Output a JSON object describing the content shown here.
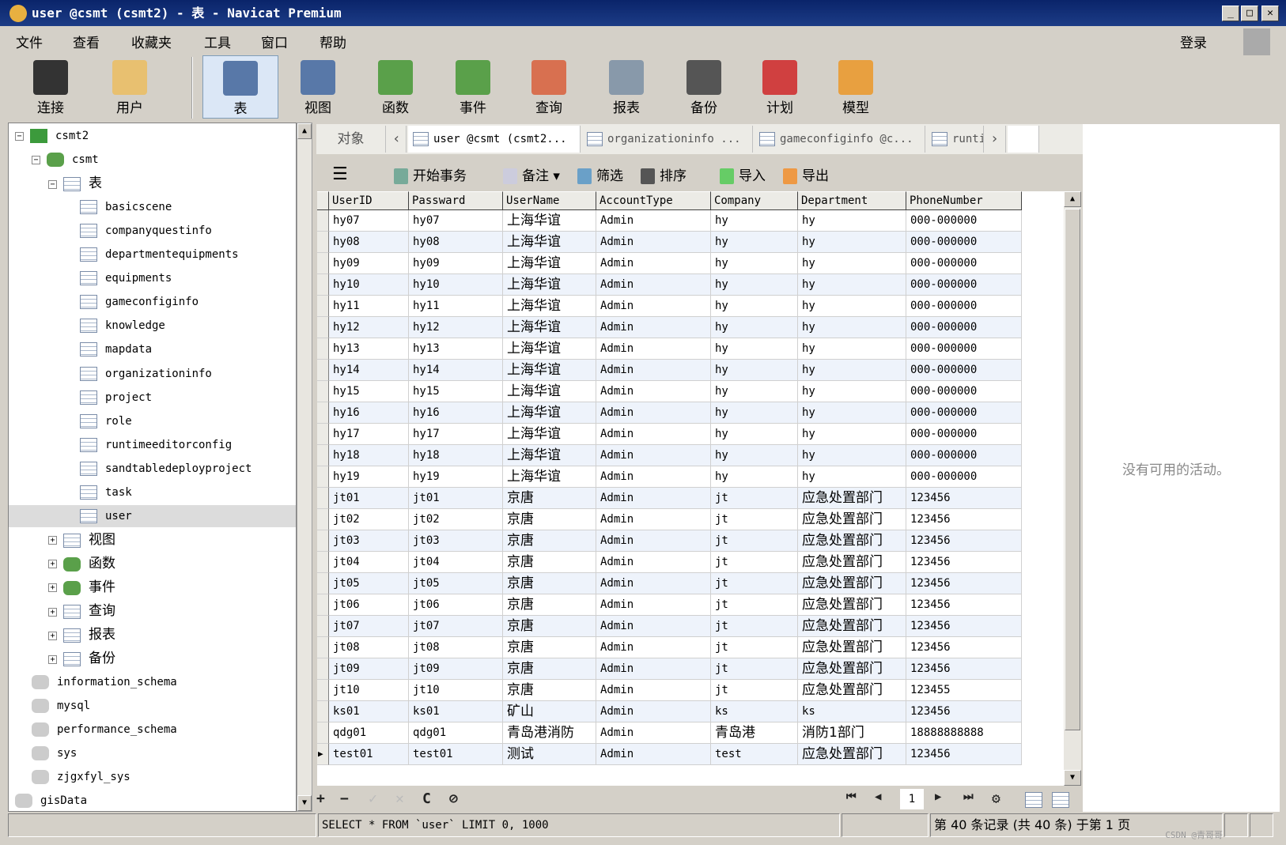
{
  "window": {
    "title": "user @csmt (csmt2) - 表 - Navicat Premium",
    "min": "_",
    "max": "□",
    "close": "✕"
  },
  "menu": [
    "文件",
    "查看",
    "收藏夹",
    "工具",
    "窗口",
    "帮助"
  ],
  "account": {
    "login": "登录"
  },
  "toolbar": [
    {
      "label": "连接",
      "icon": "connection-icon",
      "color": "#333"
    },
    {
      "label": "用户",
      "icon": "user-icon",
      "color": "#e8c070"
    },
    {
      "label": "表",
      "icon": "table-icon",
      "color": "#5878a8"
    },
    {
      "label": "视图",
      "icon": "view-icon",
      "color": "#5878a8"
    },
    {
      "label": "函数",
      "icon": "function-icon",
      "color": "#5aa04a"
    },
    {
      "label": "事件",
      "icon": "event-icon",
      "color": "#5aa04a"
    },
    {
      "label": "查询",
      "icon": "query-icon",
      "color": "#d87050"
    },
    {
      "label": "报表",
      "icon": "report-icon",
      "color": "#8899aa"
    },
    {
      "label": "备份",
      "icon": "backup-icon",
      "color": "#555"
    },
    {
      "label": "计划",
      "icon": "schedule-icon",
      "color": "#d04040"
    },
    {
      "label": "模型",
      "icon": "model-icon",
      "color": "#e8a040"
    }
  ],
  "tree": [
    {
      "label": "csmt2",
      "level": 0,
      "exp": "−",
      "icon": "conn"
    },
    {
      "label": "csmt",
      "level": 1,
      "exp": "−",
      "icon": "db"
    },
    {
      "label": "表",
      "level": 2,
      "exp": "−",
      "icon": "table"
    },
    {
      "label": "basicscene",
      "level": 3,
      "icon": "table"
    },
    {
      "label": "companyquestinfo",
      "level": 3,
      "icon": "table"
    },
    {
      "label": "departmentequipments",
      "level": 3,
      "icon": "table"
    },
    {
      "label": "equipments",
      "level": 3,
      "icon": "table"
    },
    {
      "label": "gameconfiginfo",
      "level": 3,
      "icon": "table"
    },
    {
      "label": "knowledge",
      "level": 3,
      "icon": "table"
    },
    {
      "label": "mapdata",
      "level": 3,
      "icon": "table"
    },
    {
      "label": "organizationinfo",
      "level": 3,
      "icon": "table"
    },
    {
      "label": "project",
      "level": 3,
      "icon": "table"
    },
    {
      "label": "role",
      "level": 3,
      "icon": "table"
    },
    {
      "label": "runtimeeditorconfig",
      "level": 3,
      "icon": "table"
    },
    {
      "label": "sandtabledeployproject",
      "level": 3,
      "icon": "table"
    },
    {
      "label": "task",
      "level": 3,
      "icon": "table"
    },
    {
      "label": "user",
      "level": 3,
      "icon": "table",
      "selected": true
    },
    {
      "label": "视图",
      "level": 2,
      "exp": "+",
      "icon": "table"
    },
    {
      "label": "函数",
      "level": 2,
      "exp": "+",
      "icon": "db"
    },
    {
      "label": "事件",
      "level": 2,
      "exp": "+",
      "icon": "db"
    },
    {
      "label": "查询",
      "level": 2,
      "exp": "+",
      "icon": "table"
    },
    {
      "label": "报表",
      "level": 2,
      "exp": "+",
      "icon": "table"
    },
    {
      "label": "备份",
      "level": 2,
      "exp": "+",
      "icon": "table"
    },
    {
      "label": "information_schema",
      "level": 1,
      "icon": "gray"
    },
    {
      "label": "mysql",
      "level": 1,
      "icon": "gray"
    },
    {
      "label": "performance_schema",
      "level": 1,
      "icon": "gray"
    },
    {
      "label": "sys",
      "level": 1,
      "icon": "gray"
    },
    {
      "label": "zjgxfyl_sys",
      "level": 1,
      "icon": "gray"
    },
    {
      "label": "gisData",
      "level": 0,
      "icon": "gray"
    }
  ],
  "tabs": {
    "objects": "对象",
    "items": [
      "user @csmt (csmt2...",
      "organizationinfo ...",
      "gameconfiginfo @c...",
      "runti"
    ]
  },
  "actions": {
    "begin_tx": "开始事务",
    "memo": "备注",
    "filter": "筛选",
    "sort": "排序",
    "import": "导入",
    "export": "导出"
  },
  "columns": [
    "UserID",
    "Passward",
    "UserName",
    "AccountType",
    "Company",
    "Department",
    "PhoneNumber"
  ],
  "rows": [
    [
      "hy07",
      "hy07",
      "上海华谊",
      "Admin",
      "hy",
      "hy",
      "000-000000"
    ],
    [
      "hy08",
      "hy08",
      "上海华谊",
      "Admin",
      "hy",
      "hy",
      "000-000000"
    ],
    [
      "hy09",
      "hy09",
      "上海华谊",
      "Admin",
      "hy",
      "hy",
      "000-000000"
    ],
    [
      "hy10",
      "hy10",
      "上海华谊",
      "Admin",
      "hy",
      "hy",
      "000-000000"
    ],
    [
      "hy11",
      "hy11",
      "上海华谊",
      "Admin",
      "hy",
      "hy",
      "000-000000"
    ],
    [
      "hy12",
      "hy12",
      "上海华谊",
      "Admin",
      "hy",
      "hy",
      "000-000000"
    ],
    [
      "hy13",
      "hy13",
      "上海华谊",
      "Admin",
      "hy",
      "hy",
      "000-000000"
    ],
    [
      "hy14",
      "hy14",
      "上海华谊",
      "Admin",
      "hy",
      "hy",
      "000-000000"
    ],
    [
      "hy15",
      "hy15",
      "上海华谊",
      "Admin",
      "hy",
      "hy",
      "000-000000"
    ],
    [
      "hy16",
      "hy16",
      "上海华谊",
      "Admin",
      "hy",
      "hy",
      "000-000000"
    ],
    [
      "hy17",
      "hy17",
      "上海华谊",
      "Admin",
      "hy",
      "hy",
      "000-000000"
    ],
    [
      "hy18",
      "hy18",
      "上海华谊",
      "Admin",
      "hy",
      "hy",
      "000-000000"
    ],
    [
      "hy19",
      "hy19",
      "上海华谊",
      "Admin",
      "hy",
      "hy",
      "000-000000"
    ],
    [
      "jt01",
      "jt01",
      "京唐",
      "Admin",
      "jt",
      "应急处置部门",
      "123456"
    ],
    [
      "jt02",
      "jt02",
      "京唐",
      "Admin",
      "jt",
      "应急处置部门",
      "123456"
    ],
    [
      "jt03",
      "jt03",
      "京唐",
      "Admin",
      "jt",
      "应急处置部门",
      "123456"
    ],
    [
      "jt04",
      "jt04",
      "京唐",
      "Admin",
      "jt",
      "应急处置部门",
      "123456"
    ],
    [
      "jt05",
      "jt05",
      "京唐",
      "Admin",
      "jt",
      "应急处置部门",
      "123456"
    ],
    [
      "jt06",
      "jt06",
      "京唐",
      "Admin",
      "jt",
      "应急处置部门",
      "123456"
    ],
    [
      "jt07",
      "jt07",
      "京唐",
      "Admin",
      "jt",
      "应急处置部门",
      "123456"
    ],
    [
      "jt08",
      "jt08",
      "京唐",
      "Admin",
      "jt",
      "应急处置部门",
      "123456"
    ],
    [
      "jt09",
      "jt09",
      "京唐",
      "Admin",
      "jt",
      "应急处置部门",
      "123456"
    ],
    [
      "jt10",
      "jt10",
      "京唐",
      "Admin",
      "jt",
      "应急处置部门",
      "123455"
    ],
    [
      "ks01",
      "ks01",
      "矿山",
      "Admin",
      "ks",
      "ks",
      "123456"
    ],
    [
      "qdg01",
      "qdg01",
      "青岛港消防",
      "Admin",
      "青岛港",
      "消防1部门",
      "18888888888"
    ],
    [
      "test01",
      "test01",
      "测试",
      "Admin",
      "test",
      "应急处置部门",
      "123456"
    ]
  ],
  "current_row_marker": "▶",
  "right_panel": {
    "empty": "没有可用的活动。"
  },
  "nav": {
    "add": "+",
    "delete": "−",
    "apply": "✓",
    "cancel": "✕",
    "refresh": "C",
    "stop": "⊘",
    "first": "⏮",
    "prev": "◀",
    "page": "1",
    "next": "▶",
    "last": "⏭",
    "settings": "⚙"
  },
  "status": {
    "sql": "SELECT * FROM `user` LIMIT 0, 1000",
    "records": "第 40 条记录 (共 40 条) 于第 1 页"
  },
  "watermark": "CSDN @青哥哥"
}
